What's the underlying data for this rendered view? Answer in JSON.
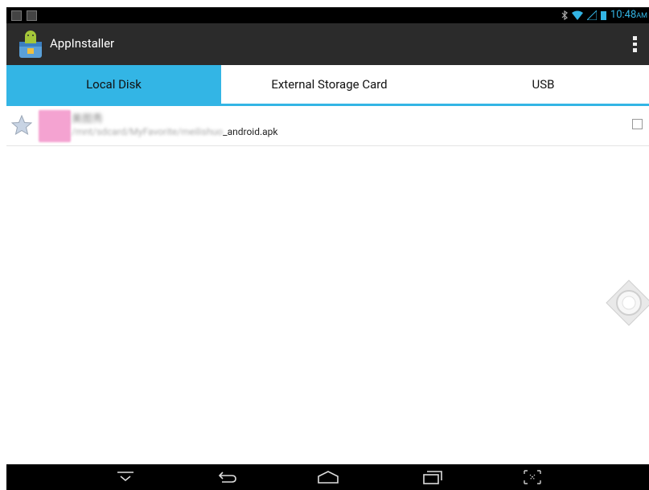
{
  "status_bar": {
    "time": "10:48",
    "ampm": "AM"
  },
  "action_bar": {
    "title": "AppInstaller"
  },
  "tabs": [
    {
      "label": "Local Disk",
      "active": true
    },
    {
      "label": "External Storage Card",
      "active": false
    },
    {
      "label": "USB",
      "active": false
    }
  ],
  "list": {
    "items": [
      {
        "title": "美图秀",
        "path_prefix": "/mnt/sdcard/MyFavorite/meilishuo",
        "path_suffix": "_android.apk",
        "checked": false
      }
    ]
  },
  "colors": {
    "accent": "#33b5e5",
    "action_bar": "#2b2b2b",
    "status_bar": "#000000",
    "nav_bar": "#000000"
  },
  "icons": [
    "android-installer-app-icon",
    "overflow-menu-icon",
    "star-icon",
    "checkbox-icon",
    "hide-keyboard-icon",
    "back-icon",
    "home-icon",
    "recents-icon",
    "screenshot-icon",
    "joystick-icon"
  ]
}
